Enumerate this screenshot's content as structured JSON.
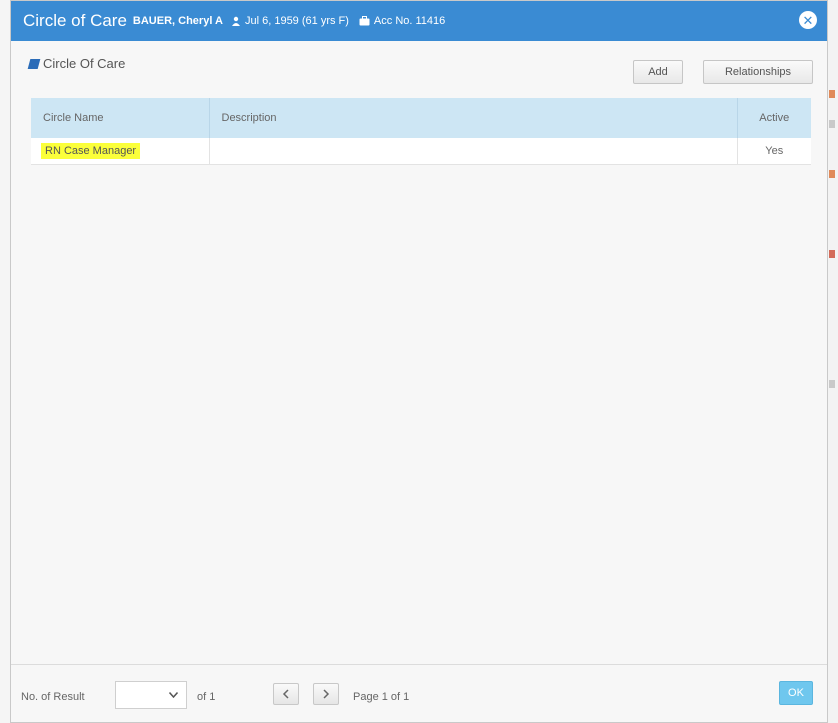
{
  "titlebar": {
    "title": "Circle of Care",
    "patient": "BAUER, Cheryl A",
    "dob": "Jul 6, 1959 (61 yrs F)",
    "acct": "Acc No. 11416"
  },
  "section": {
    "title": "Circle Of Care"
  },
  "buttons": {
    "add": "Add",
    "relationships": "Relationships",
    "ok": "OK"
  },
  "grid": {
    "columns": [
      "Circle Name",
      "Description",
      "Active"
    ],
    "rows": [
      {
        "circle_name": "RN Case Manager",
        "description": "",
        "active": "Yes"
      }
    ]
  },
  "footer": {
    "results_label": "No. of Result",
    "results_value": "",
    "of_total": "of 1",
    "page_text": "Page 1 of 1"
  },
  "colors": {
    "titlebar": "#3a8bd3",
    "header_row": "#cde6f4",
    "highlight": "#fbff3a",
    "ok_button": "#6fc7ee"
  },
  "icons": [
    "user-icon",
    "briefcase-icon",
    "close-icon",
    "chevron-down-icon",
    "chevron-left-icon",
    "chevron-right-icon",
    "section-icon"
  ]
}
